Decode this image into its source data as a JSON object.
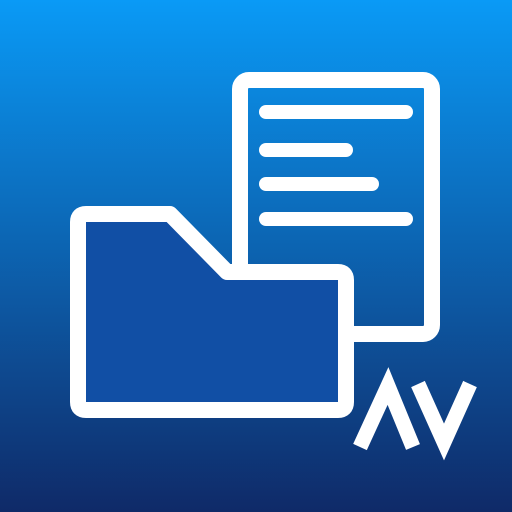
{
  "icon": {
    "name": "file-manager-app-icon",
    "brand_mark": "AV",
    "colors": {
      "gradient_top": "#0a9af6",
      "gradient_bottom": "#0f2a68",
      "stroke": "#ffffff"
    }
  }
}
